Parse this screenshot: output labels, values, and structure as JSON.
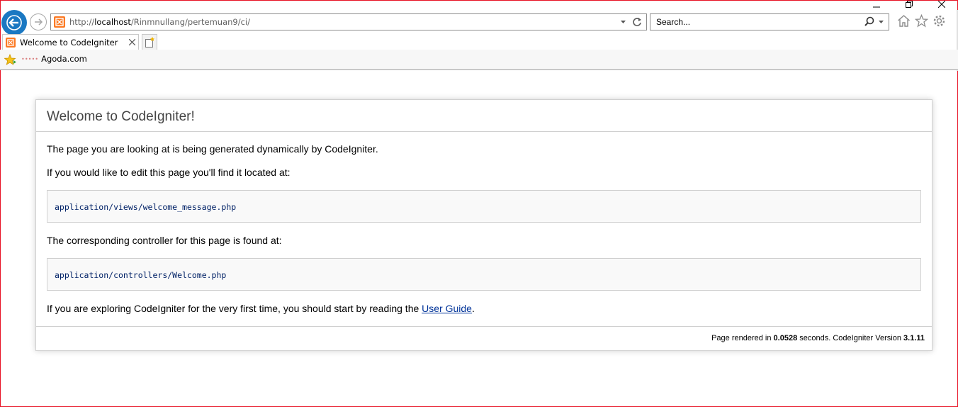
{
  "browser": {
    "address": {
      "prefix": "http://",
      "host": "localhost",
      "path": "/Rinmnullang/pertemuan9/ci/"
    },
    "search": {
      "placeholder": "Search..."
    },
    "tabs": [
      {
        "title": "Welcome to CodeIgniter"
      }
    ],
    "favorites": [
      {
        "label": "Agoda.com"
      }
    ],
    "icons": {
      "back": "back-arrow-icon",
      "forward": "forward-arrow-icon",
      "refresh": "refresh-icon",
      "home": "home-icon",
      "favorites": "star-icon",
      "settings": "gear-icon"
    },
    "colors": {
      "back_button": "#1a78c2",
      "site_icon": "#fb7a24"
    }
  },
  "page": {
    "heading": "Welcome to CodeIgniter!",
    "intro": "The page you are looking at is being generated dynamically by CodeIgniter.",
    "edit_label": "If you would like to edit this page you'll find it located at:",
    "view_path": "application/views/welcome_message.php",
    "controller_label": "The corresponding controller for this page is found at:",
    "controller_path": "application/controllers/Welcome.php",
    "explore_text": "If you are exploring CodeIgniter for the very first time, you should start by reading the ",
    "guide_link": "User Guide",
    "explore_end": ".",
    "footer": {
      "rendered_prefix": "Page rendered in ",
      "elapsed": "0.0528",
      "rendered_suffix": " seconds. CodeIgniter Version ",
      "version": "3.1.11"
    },
    "colors": {
      "code_text": "#002166",
      "link": "#003399",
      "heading": "#444444"
    }
  }
}
